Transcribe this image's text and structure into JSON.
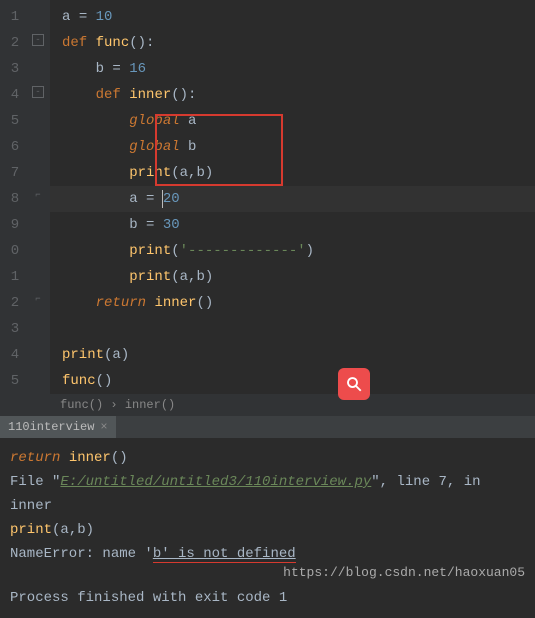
{
  "gutter": [
    "1",
    "2",
    "3",
    "4",
    "5",
    "6",
    "7",
    "8",
    "9",
    "0",
    "1",
    "2",
    "3",
    "4",
    "5"
  ],
  "code": {
    "l1": {
      "v": "a",
      "eq": "=",
      "n": "10"
    },
    "l2": {
      "kw": "def",
      "fn": "func",
      "p": "():"
    },
    "l3": {
      "v": "b",
      "eq": "=",
      "n": "16"
    },
    "l4": {
      "kw": "def",
      "fn": "inner",
      "p": "():"
    },
    "l5": {
      "kw": "global",
      "v": "a"
    },
    "l6": {
      "kw": "global",
      "v": "b"
    },
    "l7": {
      "fn": "print",
      "args": "(a,b)"
    },
    "l8": {
      "v": "a",
      "eq": "=",
      "n": "20"
    },
    "l9": {
      "v": "b",
      "eq": "=",
      "n": "30"
    },
    "l10": {
      "fn": "print",
      "lp": "(",
      "str": "'-------------'",
      "rp": ")"
    },
    "l11": {
      "fn": "print",
      "args": "(a,b)"
    },
    "l12": {
      "kw": "return",
      "fn": "inner",
      "p": "()"
    },
    "l14": {
      "fn": "print",
      "args": "(a)"
    },
    "l15": {
      "fn": "func",
      "p": "()"
    }
  },
  "breadcrumb": {
    "a": "func()",
    "sep": "›",
    "b": "inner()"
  },
  "tab": {
    "name": "110interview",
    "close": "×"
  },
  "console": {
    "r1": {
      "kw": "return",
      "fn": "inner",
      "p": "()"
    },
    "r2": {
      "pre": "File \"",
      "path": "E:/untitled/untitled3/110interview.py",
      "post": "\", line 7, in inner"
    },
    "r3": {
      "fn": "print",
      "args": "(a,b)"
    },
    "r4": {
      "pre": "NameError: name '",
      "err": "b' is not defined"
    },
    "r5": "Process finished with exit code 1"
  },
  "watermark": "https://blog.csdn.net/haoxuan05"
}
